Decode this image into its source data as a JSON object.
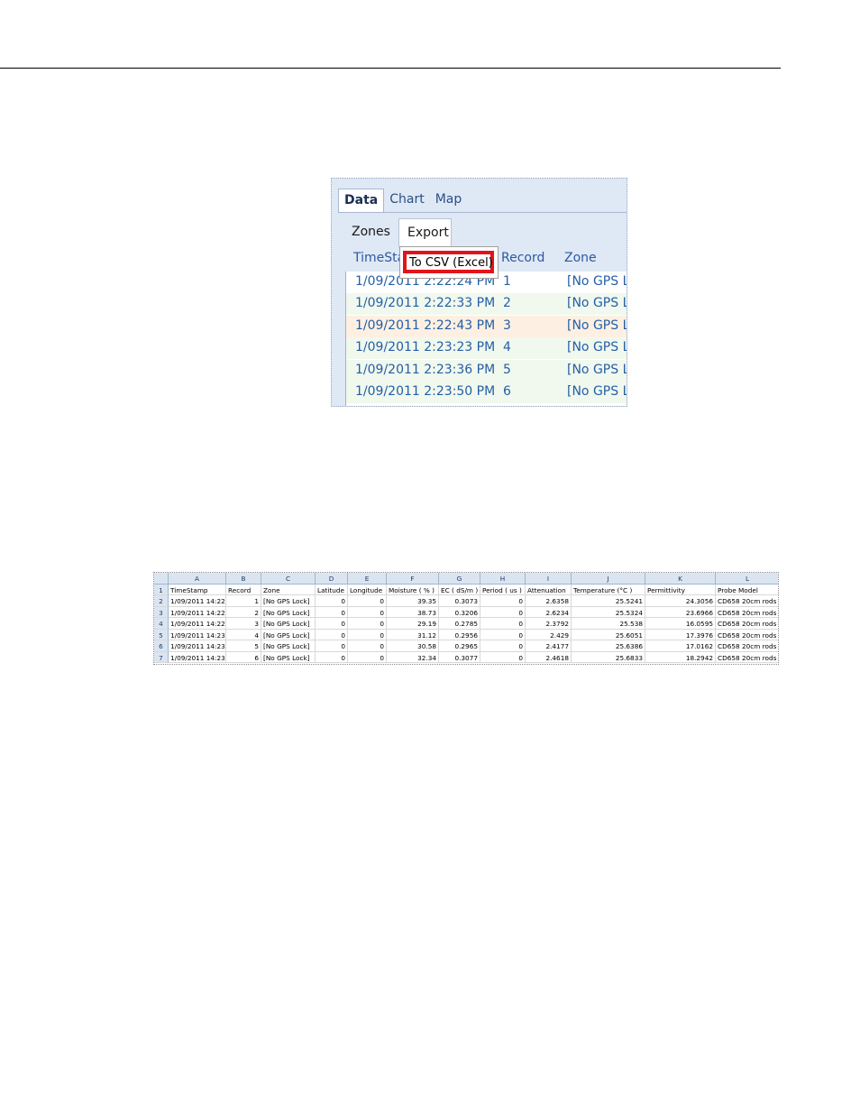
{
  "app": {
    "tabs": [
      "Data",
      "Chart",
      "Map"
    ],
    "active_tab": "Data",
    "subtabs": {
      "zones": "Zones",
      "export": "Export"
    },
    "dropdown": {
      "csv_label": "To CSV (Excel)"
    },
    "columns": {
      "timestamp": "TimeSta",
      "record": "Record",
      "zone": "Zone"
    },
    "rows": [
      {
        "timestamp": "1/09/2011 2:22:24 PM",
        "record": "1",
        "zone": "[No GPS Lc"
      },
      {
        "timestamp": "1/09/2011 2:22:33 PM",
        "record": "2",
        "zone": "[No GPS Lc"
      },
      {
        "timestamp": "1/09/2011 2:22:43 PM",
        "record": "3",
        "zone": "[No GPS Lc"
      },
      {
        "timestamp": "1/09/2011 2:23:23 PM",
        "record": "4",
        "zone": "[No GPS Lc"
      },
      {
        "timestamp": "1/09/2011 2:23:36 PM",
        "record": "5",
        "zone": "[No GPS Lc"
      },
      {
        "timestamp": "1/09/2011 2:23:50 PM",
        "record": "6",
        "zone": "[No GPS Lc"
      }
    ],
    "colors": {
      "highlight": "#e3131b",
      "selected_row": "#fdf0e2",
      "alt_row": "#f1f8ee",
      "text": "#235fa6"
    }
  },
  "sheet": {
    "col_letters": [
      "A",
      "B",
      "C",
      "D",
      "E",
      "F",
      "G",
      "H",
      "I",
      "J",
      "K",
      "L"
    ],
    "header_row_num": "1",
    "headers": [
      "TimeStamp",
      "Record",
      "Zone",
      "Latitude",
      "Longitude",
      "Moisture ( % )",
      "EC ( dS/m )",
      "Period ( us )",
      "Attenuation",
      "Temperature (°C )",
      "Permittivity",
      "Probe Model"
    ],
    "rows": [
      {
        "num": "2",
        "cells": [
          "1/09/2011 14:22",
          "1",
          "[No GPS Lock]",
          "0",
          "0",
          "39.35",
          "0.3073",
          "0",
          "2.6358",
          "25.5241",
          "24.3056",
          "CD658 20cm rods"
        ]
      },
      {
        "num": "3",
        "cells": [
          "1/09/2011 14:22",
          "2",
          "[No GPS Lock]",
          "0",
          "0",
          "38.73",
          "0.3206",
          "0",
          "2.6234",
          "25.5324",
          "23.6966",
          "CD658 20cm rods"
        ]
      },
      {
        "num": "4",
        "cells": [
          "1/09/2011 14:22",
          "3",
          "[No GPS Lock]",
          "0",
          "0",
          "29.19",
          "0.2785",
          "0",
          "2.3792",
          "25.538",
          "16.0595",
          "CD658 20cm rods"
        ]
      },
      {
        "num": "5",
        "cells": [
          "1/09/2011 14:23",
          "4",
          "[No GPS Lock]",
          "0",
          "0",
          "31.12",
          "0.2956",
          "0",
          "2.429",
          "25.6051",
          "17.3976",
          "CD658 20cm rods"
        ]
      },
      {
        "num": "6",
        "cells": [
          "1/09/2011 14:23",
          "5",
          "[No GPS Lock]",
          "0",
          "0",
          "30.58",
          "0.2965",
          "0",
          "2.4177",
          "25.6386",
          "17.0162",
          "CD658 20cm rods"
        ]
      },
      {
        "num": "7",
        "cells": [
          "1/09/2011 14:23",
          "6",
          "[No GPS Lock]",
          "0",
          "0",
          "32.34",
          "0.3077",
          "0",
          "2.4618",
          "25.6833",
          "18.2942",
          "CD658 20cm rods"
        ]
      }
    ]
  }
}
